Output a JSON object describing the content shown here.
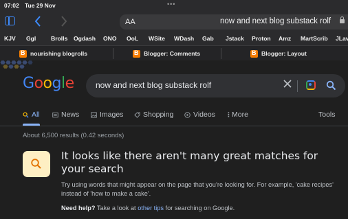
{
  "status_bar": {
    "time": "07:02",
    "date": "Tue 29 Nov",
    "dots": "•••"
  },
  "browser": {
    "back_icon": "chevron-left-icon",
    "forward_icon": "chevron-right-icon",
    "address": {
      "reader_label": "AA",
      "url_text": "now and next blog substack rolf"
    }
  },
  "bookmarks": [
    "KJV",
    "Ggl",
    "Brolls",
    "Ogdash",
    "ONO",
    "OoL",
    "WSite",
    "WDash",
    "Gab",
    "Jstack",
    "Proton",
    "Amz",
    "MartScrib",
    "JLav"
  ],
  "tabs": [
    {
      "label": "nourishing blogrolls"
    },
    {
      "label": "Blogger: Comments"
    },
    {
      "label": "Blogger: Layout"
    }
  ],
  "google": {
    "logo": [
      "G",
      "o",
      "o",
      "g",
      "l",
      "e"
    ],
    "logo_colors": [
      "#4285f4",
      "#ea4335",
      "#fbbc05",
      "#4285f4",
      "#34a853",
      "#ea4335"
    ],
    "query": "now and next blog substack rolf",
    "nav": {
      "all": "All",
      "news": "News",
      "images": "Images",
      "shopping": "Shopping",
      "videos": "Videos",
      "more": "More",
      "tools": "Tools"
    },
    "results_count": "About 6,500 results (0.42 seconds)",
    "notice": {
      "title": "It looks like there aren't many great matches for your search",
      "body": "Try using words that might appear on the page that you’re looking for. For example, 'cake recipes' instead of 'how to make a cake'.",
      "help_label": "Need help?",
      "help_pre": "Take a look at",
      "help_link": "other tips",
      "help_post": "for searching on Google."
    }
  }
}
